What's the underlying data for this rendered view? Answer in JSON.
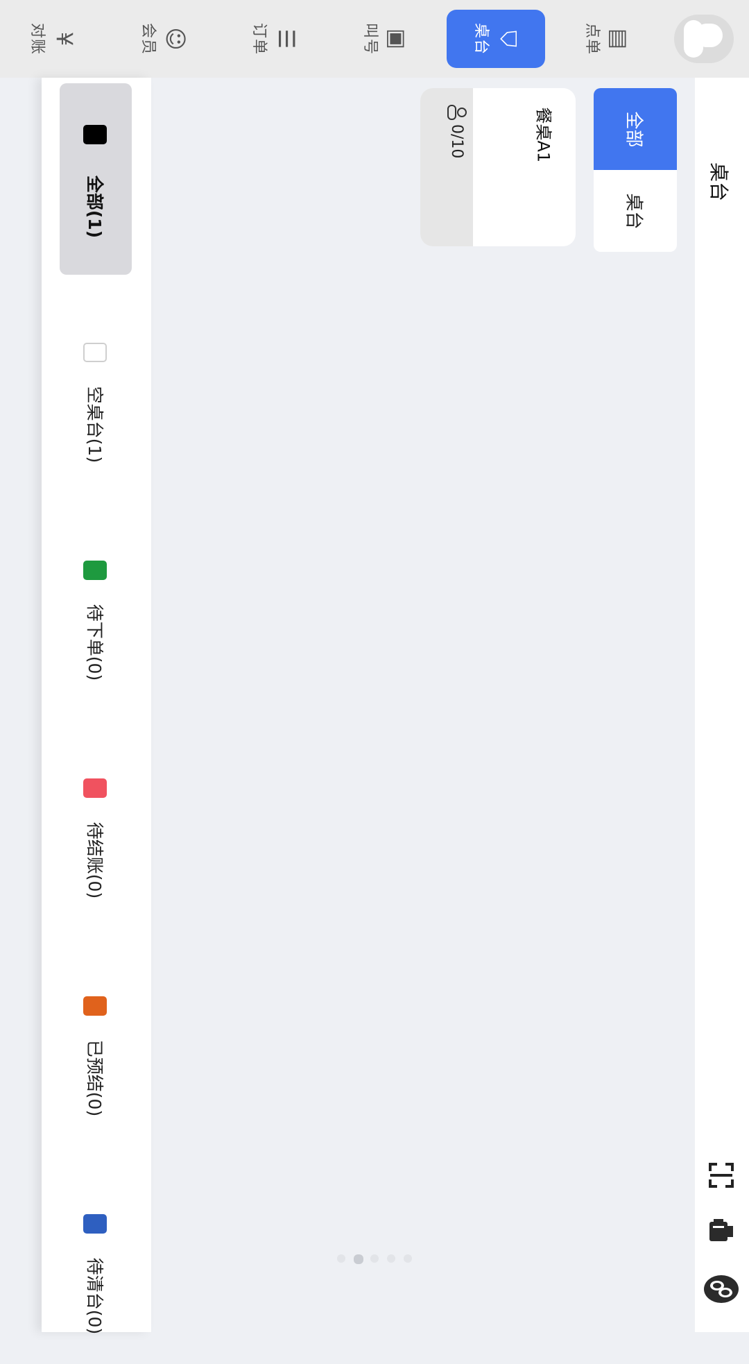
{
  "topbar": {
    "tabs": [
      {
        "key": "order_food",
        "label": "点单",
        "icon": "menu-book-icon",
        "glyph": "▤",
        "active": false
      },
      {
        "key": "table",
        "label": "桌台",
        "icon": "dining-table-icon",
        "glyph": "⛉",
        "active": true
      },
      {
        "key": "queue",
        "label": "叫号",
        "icon": "queue-number-icon",
        "glyph": "▣",
        "active": false
      },
      {
        "key": "orders",
        "label": "订单",
        "icon": "order-list-icon",
        "glyph": "☰",
        "active": false
      },
      {
        "key": "member",
        "label": "会员",
        "icon": "member-icon",
        "glyph": "☺",
        "active": false
      },
      {
        "key": "reconcile",
        "label": "对账",
        "icon": "yen-coin-icon",
        "glyph": "¥",
        "active": false
      }
    ]
  },
  "page": {
    "title": "桌台"
  },
  "categories": [
    {
      "label": "全部",
      "active": true
    },
    {
      "label": "桌台",
      "active": false
    }
  ],
  "table_card": {
    "name": "餐桌A1",
    "seats": "0/10"
  },
  "statuses": [
    {
      "label": "全部(1)",
      "color": "#000000",
      "selected": true
    },
    {
      "label": "空桌台(1)",
      "color": "#ffffff",
      "selected": false
    },
    {
      "label": "待下单(0)",
      "color": "#1e9a3f",
      "selected": false
    },
    {
      "label": "待结账(0)",
      "color": "#f0525f",
      "selected": false
    },
    {
      "label": "已预结(0)",
      "color": "#e0621c",
      "selected": false
    },
    {
      "label": "待清台(0)",
      "color": "#2e5fc0",
      "selected": false
    }
  ],
  "toolbar": {
    "icons": [
      "scan-icon",
      "printer-icon",
      "peanut-logo-icon"
    ]
  },
  "pagination": {
    "count": 5,
    "active_index": 1
  }
}
